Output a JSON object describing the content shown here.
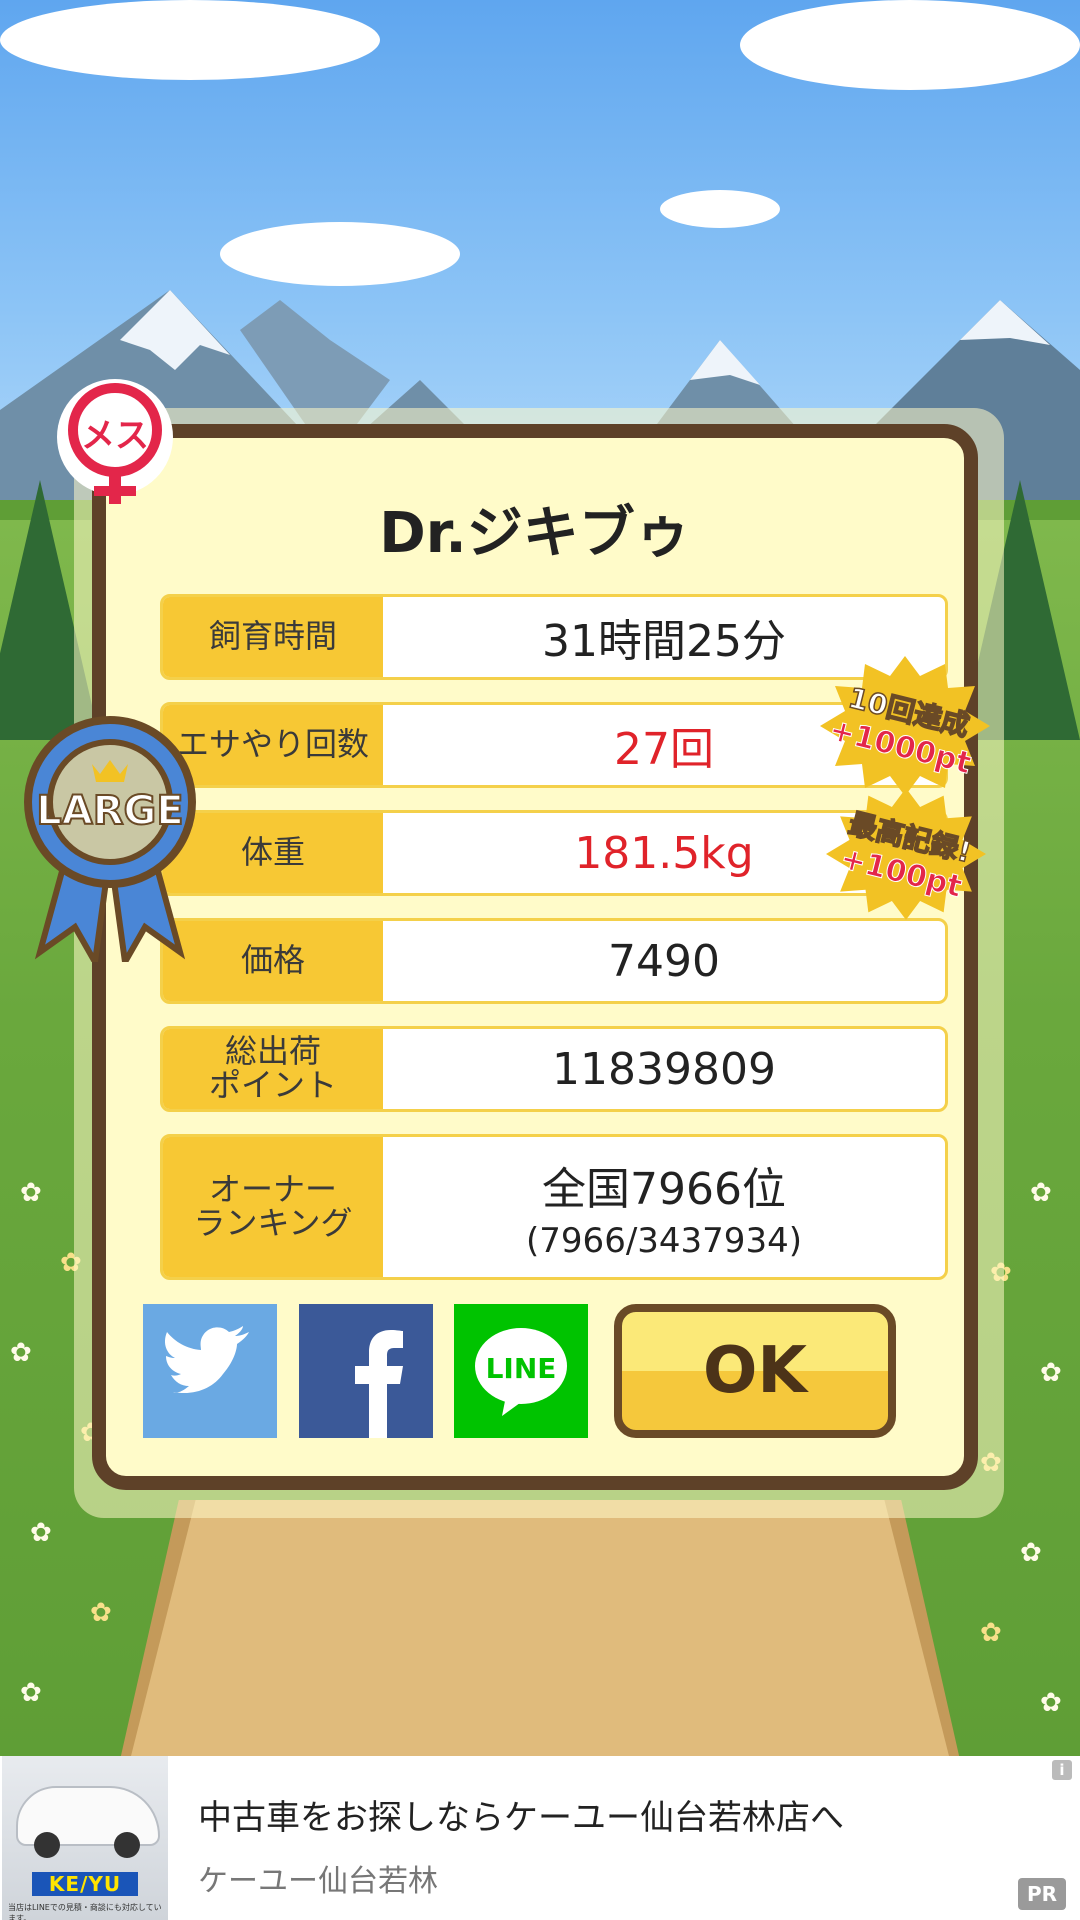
{
  "pet": {
    "name": "Dr.ジキブゥ",
    "gender_label": "メス",
    "size_badge": "LARGE"
  },
  "stats": [
    {
      "label": "飼育時間",
      "value": "31時間25分",
      "highlight": false
    },
    {
      "label": "エサやり回数",
      "value": "27回",
      "highlight": true
    },
    {
      "label": "体重",
      "value": "181.5kg",
      "highlight": true
    },
    {
      "label": "価格",
      "value": "7490",
      "highlight": false
    },
    {
      "label": "総出荷\nポイント",
      "value": "11839809",
      "highlight": false
    },
    {
      "label": "オーナー\nランキング",
      "value": "全国7966位",
      "sub": "(7966/3437934)",
      "highlight": false
    }
  ],
  "rewards": [
    {
      "line1": "10回達成",
      "line2": "+1000pt"
    },
    {
      "line1": "最高記録!",
      "line2": "+100pt"
    }
  ],
  "buttons": {
    "twitter_icon": "twitter-bird-icon",
    "facebook_icon": "facebook-f-icon",
    "line_label": "LINE",
    "ok_label": "OK"
  },
  "ad": {
    "headline": "中古車をお探しならケーユー仙台若林店へ",
    "advertiser": "ケーユー仙台若林",
    "logo_text": "KE/YU",
    "fine_print": "当店はLINEでの見積・商談にも対応しています。",
    "info_label": "i",
    "pr_label": "PR"
  },
  "colors": {
    "card_bg": "#fffbc9",
    "card_border": "#5e4128",
    "label_bg": "#f7c834",
    "highlight_text": "#e0232a",
    "female_badge": "#e3264a",
    "ribbon_blue": "#4a86d6",
    "burst_gold": "#f2c224"
  }
}
